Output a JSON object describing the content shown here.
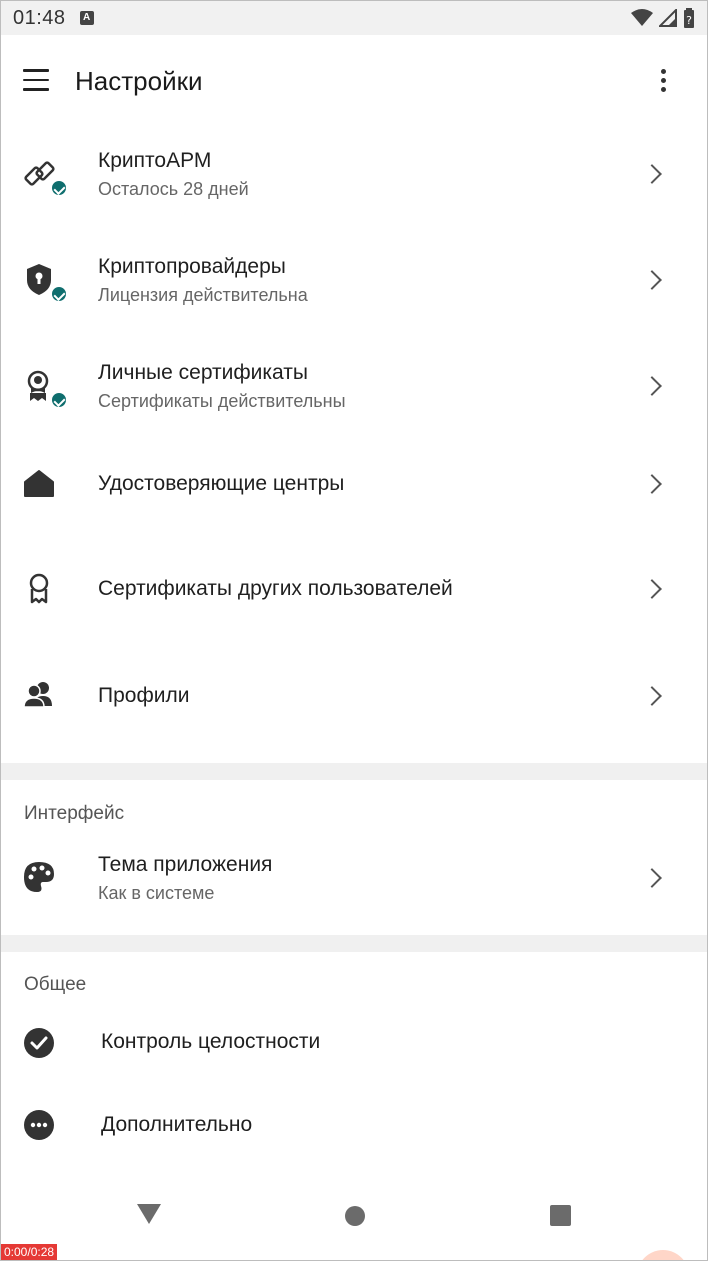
{
  "status_bar": {
    "time": "01:48",
    "notif_glyph": "A",
    "battery_glyph": "?",
    "icons": [
      "wifi-icon",
      "cell-signal-icon",
      "battery-icon"
    ]
  },
  "app_bar": {
    "title": "Настройки",
    "menu_icon": "hamburger-menu-icon",
    "more_icon": "more-vert-icon"
  },
  "items": [
    {
      "label": "КриптоАРМ",
      "sub": "Осталось 28 дней",
      "icon": "link-chain-icon",
      "badge": true
    },
    {
      "label": "Криптопровайдеры",
      "sub": "Лицензия действительна",
      "icon": "shield-lock-icon",
      "badge": true
    },
    {
      "label": "Личные сертификаты",
      "sub": "Сертификаты действительны",
      "icon": "certificate-person-icon",
      "badge": true
    },
    {
      "label": "Удостоверяющие центры",
      "sub": "",
      "icon": "house-icon",
      "badge": false
    },
    {
      "label": "Сертификаты других пользователей",
      "sub": "",
      "icon": "award-ribbon-icon",
      "badge": false
    },
    {
      "label": "Профили",
      "sub": "",
      "icon": "people-icon",
      "badge": false
    }
  ],
  "section_interface": {
    "title": "Интерфейс",
    "item": {
      "label": "Тема приложения",
      "sub": "Как в системе",
      "icon": "palette-icon"
    }
  },
  "section_general": {
    "title": "Общее",
    "items": [
      {
        "label": "Контроль целостности",
        "icon": "check-circle-icon"
      },
      {
        "label": "Дополнительно",
        "icon": "more-horiz-circle-icon"
      }
    ]
  },
  "nav_bar": {
    "back": "back-triangle-icon",
    "home": "home-circle-icon",
    "recent": "recent-square-icon"
  },
  "timer": "0:00/0:28",
  "colors": {
    "badge": "#0f6e6e",
    "divider": "#f0f0f0",
    "status_bar_bg": "#f1f1f1",
    "icon": "#333333"
  }
}
